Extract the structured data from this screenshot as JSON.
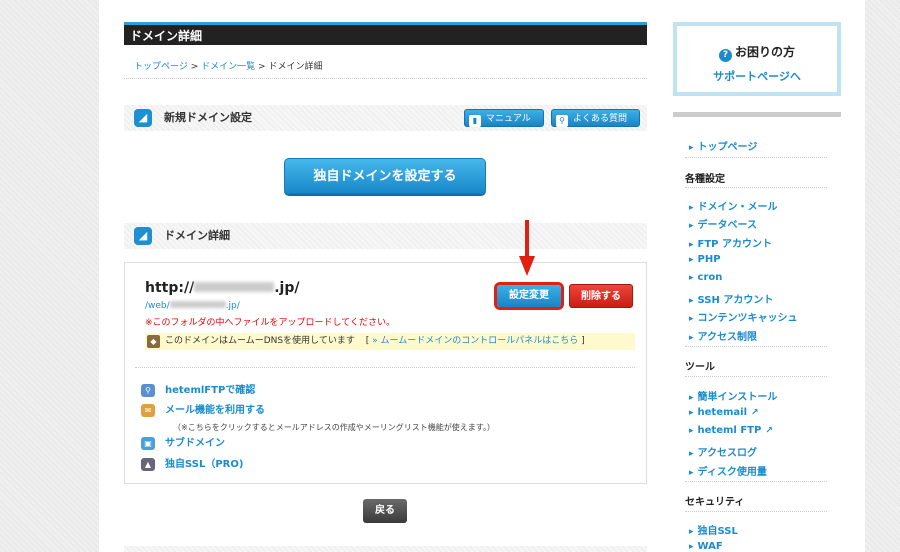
{
  "main": {
    "page_title": "ドメイン詳細",
    "breadcrumb": {
      "home": "トップページ",
      "list": "ドメイン一覧",
      "current": "ドメイン詳細",
      "sep": ">"
    },
    "new_domain_section": {
      "title": "新規ドメイン設定",
      "manual_label": "マニュアル",
      "faq_label": "よくある質問"
    },
    "set_domain_button": "独自ドメインを設定する",
    "detail_section": {
      "title": "ドメイン詳細"
    },
    "domain": {
      "prefix": "http://",
      "suffix": ".jp/",
      "web_prefix": "/web/",
      "web_suffix": ".jp/",
      "warning": "※このフォルダの中へファイルをアップロードしてください。",
      "dns_notice": "このドメインはムームーDNSを使用しています",
      "dns_link": "» ムームードメインのコントロールパネルはこちら",
      "bracket_open": "[",
      "bracket_close": "]",
      "settings_button": "設定変更",
      "delete_button": "削除する"
    },
    "links": [
      {
        "label": "hetemlFTPで確認",
        "icon": "magnifier-icon"
      },
      {
        "label": "メール機能を利用する",
        "icon": "mail-icon"
      },
      {
        "label": "サブドメイン",
        "icon": "subdomain-icon"
      },
      {
        "label": "独自SSL（PRO)",
        "icon": "lock-icon"
      }
    ],
    "mail_note": "（※こちらをクリックするとメールアドレスの作成やメーリングリスト機能が使えます。）",
    "back_button": "戻る"
  },
  "sidebar": {
    "help_title": "お困りの方",
    "help_link": "サポートページへ",
    "top_link": "トップページ",
    "sections": [
      {
        "heading": "各種設定",
        "items": [
          "ドメイン・メール",
          "データベース",
          "FTP アカウント",
          "PHP",
          "cron",
          "SSH アカウント",
          "コンテンツキャッシュ",
          "アクセス制限"
        ]
      },
      {
        "heading": "ツール",
        "items": [
          "簡単インストール",
          "hetemail",
          "heteml FTP",
          "アクセスログ",
          "ディスク使用量"
        ]
      },
      {
        "heading": "セキュリティ",
        "items": [
          "独自SSL",
          "WAF"
        ]
      }
    ]
  },
  "colors": {
    "accent": "#1a8ccd",
    "danger": "#d9261c",
    "highlight": "#e02010"
  }
}
